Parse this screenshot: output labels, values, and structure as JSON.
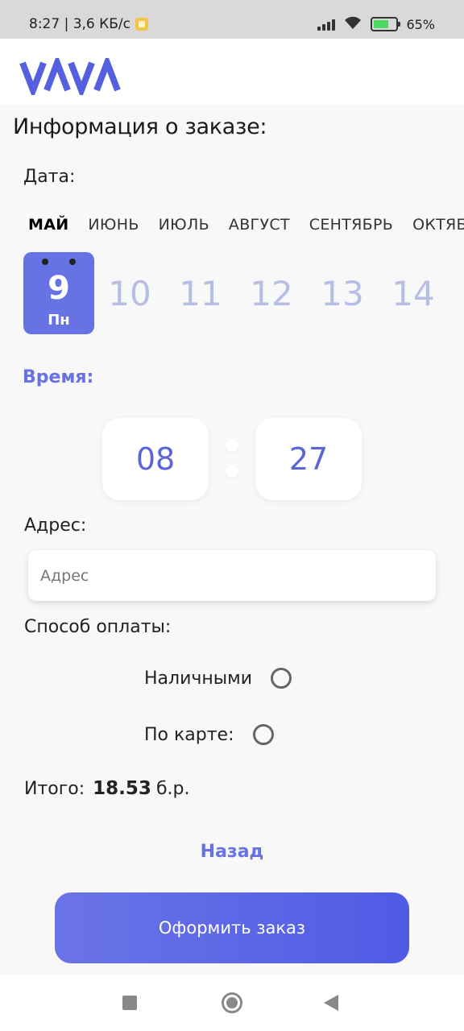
{
  "status_bar": {
    "time_speed": "8:27 | 3,6 КБ/с",
    "battery": "65%"
  },
  "logo": "VAAV",
  "page_title": "Информация о заказе:",
  "date_section": {
    "label": "Дата:",
    "months": [
      "МАЙ",
      "ИЮНЬ",
      "ИЮЛЬ",
      "АВГУСТ",
      "СЕНТЯБРЬ",
      "ОКТЯБРЬ"
    ],
    "selected_month": "МАЙ",
    "selected_day": {
      "number": "9",
      "weekday": "Пн"
    },
    "days": [
      "10",
      "11",
      "12",
      "13",
      "14"
    ]
  },
  "time_section": {
    "label": "Время:",
    "hours": "08",
    "minutes": "27"
  },
  "address_section": {
    "label": "Адрес:",
    "placeholder": "Адрес"
  },
  "payment_section": {
    "label": "Способ оплаты:",
    "options": [
      {
        "label": "Наличными",
        "selected": false
      },
      {
        "label": "По карте:",
        "selected": false
      }
    ]
  },
  "total": {
    "label": "Итого:",
    "amount": "18.53",
    "currency": "б.р."
  },
  "back_label": "Назад",
  "submit_label": "Оформить заказ",
  "colors": {
    "accent": "#6772e5",
    "day_inactive": "#b8bde6",
    "button_start": "#6b74e6",
    "button_end": "#4f5be6"
  }
}
